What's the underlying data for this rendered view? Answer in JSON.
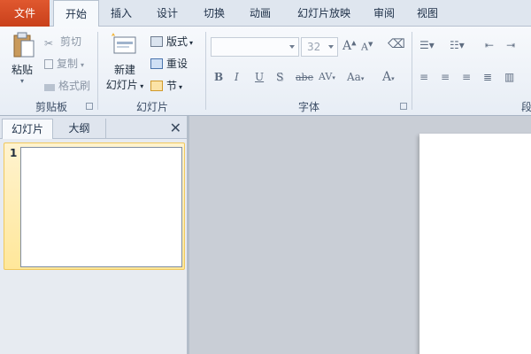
{
  "tabs": [
    "文件",
    "开始",
    "插入",
    "设计",
    "切换",
    "动画",
    "幻灯片放映",
    "审阅",
    "视图"
  ],
  "clipboard": {
    "paste": "粘贴",
    "cut": "剪切",
    "copy": "复制",
    "format_painter": "格式刷",
    "group_label": "剪贴板"
  },
  "slides_group": {
    "new_slide_line1": "新建",
    "new_slide_line2": "幻灯片",
    "layout": "版式",
    "reset": "重设",
    "section": "节",
    "group_label": "幻灯片"
  },
  "font_group": {
    "font_name": "",
    "font_size": "32",
    "grow": "A",
    "shrink": "A",
    "bold": "B",
    "italic": "I",
    "underline": "U",
    "shadow": "S",
    "strike": "abe",
    "spacing": "AV",
    "case": "Aa",
    "color": "A",
    "group_label": "字体"
  },
  "paragraph_group": {
    "group_label_partial": "段"
  },
  "pane": {
    "tab_slides": "幻灯片",
    "tab_outline": "大纲",
    "close": "✕",
    "slide_number": "1"
  },
  "colors": {
    "file_tab": "#d24a22",
    "ribbon_bg": "#eef2f7",
    "selection": "#ffe79a",
    "workspace": "#c9ced6"
  }
}
